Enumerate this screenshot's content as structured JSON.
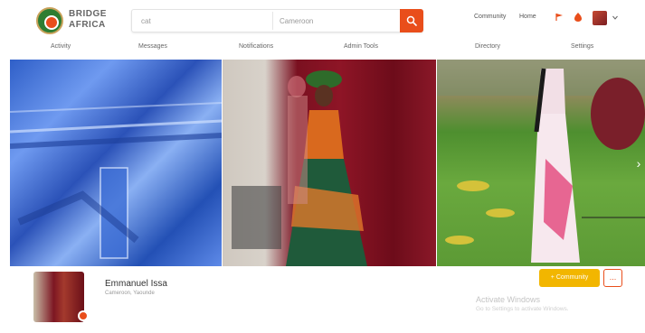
{
  "brand": {
    "line1": "BRIDGE",
    "line2": "AFRICA",
    "colors": {
      "green": "#2e7d32",
      "orange": "#e94e1b",
      "gold": "#c8a15a"
    }
  },
  "search": {
    "query": "cat",
    "location": "Cameroon",
    "button_icon": "search-icon"
  },
  "top_right": {
    "link1": "Community",
    "link2": "Home",
    "icons": [
      "flag-icon",
      "notification-icon"
    ],
    "avatar_chevron": "chevron-down-icon"
  },
  "nav": [
    "Activity",
    "Messages",
    "Notifications",
    "Admin Tools",
    "Directory",
    "Settings"
  ],
  "gallery": {
    "photo_icons": [
      "fabric-photo",
      "dress-photo",
      "outdoor-dress-photo"
    ],
    "next_icon": "chevron-right-icon"
  },
  "profile": {
    "name": "Emmanuel Issa",
    "subtitle": "Cameroon, Yaounde",
    "follow_label": "+ Community",
    "more_label": "...",
    "watermark_title": "Activate Windows",
    "watermark_sub": "Go to Settings to activate Windows."
  },
  "colors": {
    "accent": "#e94e1b",
    "follow": "#f2b600"
  }
}
